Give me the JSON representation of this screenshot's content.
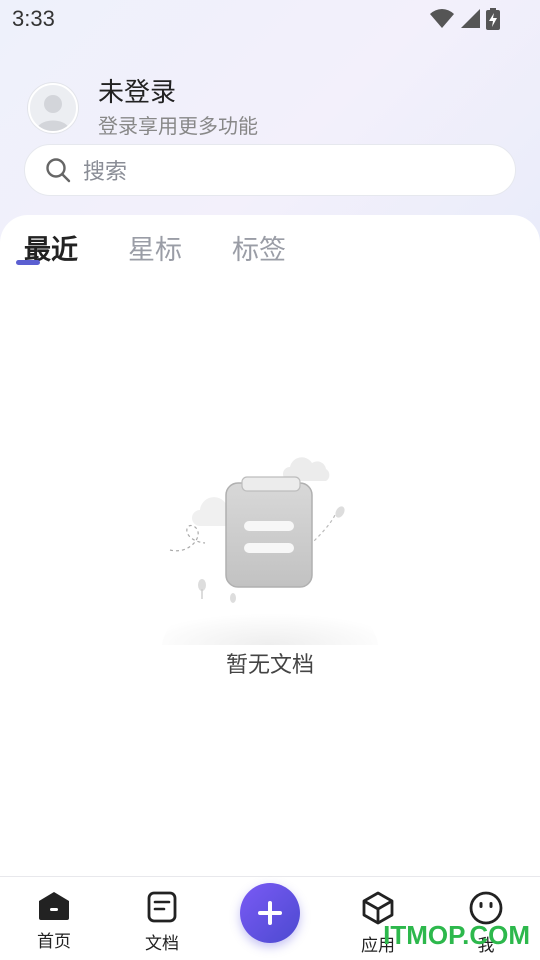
{
  "status_bar": {
    "time": "3:33",
    "icons": [
      "wifi-icon",
      "cell-signal-icon",
      "battery-charging-icon"
    ]
  },
  "user": {
    "name": "未登录",
    "subtitle": "登录享用更多功能",
    "avatar_icon": "default-avatar-icon"
  },
  "search": {
    "placeholder": "搜索",
    "icon": "search-icon"
  },
  "tabs": [
    {
      "label": "最近",
      "active": true
    },
    {
      "label": "星标",
      "active": false
    },
    {
      "label": "标签",
      "active": false
    }
  ],
  "empty_state": {
    "text": "暂无文档",
    "illustration": "empty-document-illustration"
  },
  "bottom_nav": {
    "items": [
      {
        "label": "首页",
        "icon": "home-icon",
        "active": true
      },
      {
        "label": "文档",
        "icon": "document-icon",
        "active": false
      },
      {
        "label": "应用",
        "icon": "apps-cube-icon",
        "active": false
      },
      {
        "label": "我",
        "icon": "profile-face-icon",
        "active": false
      }
    ],
    "fab_icon": "plus-icon"
  },
  "watermark": "ITMOP.COM",
  "colors": {
    "accent": "#5b5fd1",
    "fab_start": "#7a5af5",
    "fab_end": "#4c4ad0",
    "watermark": "#2db84c"
  }
}
